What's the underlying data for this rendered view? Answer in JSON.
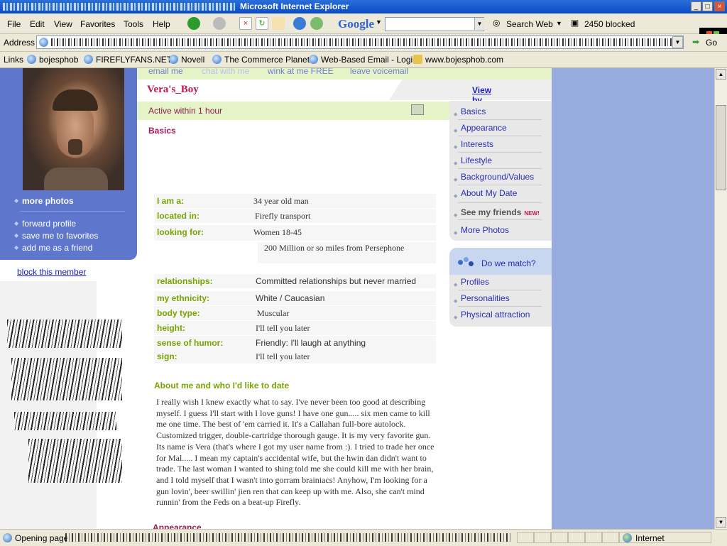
{
  "window": {
    "title": "Microsoft Internet Explorer",
    "controls": [
      "_",
      "□",
      "×"
    ]
  },
  "menubar": {
    "items": [
      "File",
      "Edit",
      "View",
      "Favorites",
      "Tools",
      "Help"
    ],
    "google_label": "Google",
    "search_web_label": "Search Web",
    "blocked_label": "2450 blocked"
  },
  "addressbar": {
    "label": "Address",
    "go_label": "Go"
  },
  "links": {
    "label": "Links",
    "items": [
      "bojesphob",
      "FIREFLYFANS.NET",
      "Novell",
      "The Commerce Planet",
      "Web-Based Email - Login",
      "www.bojesphob.com"
    ]
  },
  "left": {
    "more_photos": "more photos",
    "forward_profile": "forward profile",
    "save_favorites": "save me to favorites",
    "add_friend": "add me as a friend",
    "block_member": "block this member"
  },
  "center": {
    "tabs": [
      "email me",
      "chat with me",
      "wink at me FREE",
      "leave voicemail"
    ],
    "username": "Vera's_Boy",
    "view_by_section": "View by Section",
    "active_status": "Active within 1 hour",
    "basics_title": "Basics",
    "basics_rows": [
      {
        "label": "I am a:",
        "value": "34 year old man"
      },
      {
        "label": "located in:",
        "value": "Firefly transport"
      },
      {
        "label": "looking for:",
        "value": "Women 18-45"
      }
    ],
    "looking_extra": "200 Million or so miles from Persephone",
    "detail_rows": [
      {
        "label": "relationships:",
        "value": "Committed relationships but never married"
      },
      {
        "label": "my ethnicity:",
        "value": "White / Caucasian"
      },
      {
        "label": "body type:",
        "value": "Muscular"
      },
      {
        "label": "height:",
        "value": "I'll tell you later"
      },
      {
        "label": "sense of humor:",
        "value": "Friendly: I'll laugh at anything"
      },
      {
        "label": "sign:",
        "value": "I'll tell you later"
      }
    ],
    "about_title": "About me and who I'd like to date",
    "about_text": "I really wish I knew exactly what to say.  I've never been too good at describing myself.  I guess I'll start with I love guns! I have one gun..... six men came to kill me one time. The best of 'em carried it. It's a Callahan full-bore autolock. Customized trigger, double-cartridge thorough gauge. It is my very favorite gun. Its name is Vera (that's where I got my user name from :). I tried to trade her once for Mal..... I mean my captain's accidental wife, but the hwin dan didn't want to trade. The last woman I wanted to shing told me she could kill me with her brain, and I told myself that I wasn't into gorram brainiacs! Anyhow, I'm looking for a gun lovin', beer swillin' jien ren that can keep up with me. Also, she can't mind runnin' from the Feds on a beat-up Firefly.",
    "appearance_title": "Appearance"
  },
  "nav": {
    "items": [
      "Basics",
      "Appearance",
      "Interests",
      "Lifestyle",
      "Background/Values",
      "About My Date"
    ],
    "friends": "See my friends",
    "new_badge": "NEW!",
    "more_photos": "More Photos",
    "match": "Do we match?",
    "match_items": [
      "Profiles",
      "Personalities",
      "Physical attraction"
    ]
  },
  "status": {
    "text": "Opening page",
    "zone": "Internet"
  },
  "colors": {
    "brand_blue": "#5e76cc",
    "name_pink": "#c4154d",
    "label_green": "#79a300",
    "link_blue": "#2a2fb6"
  }
}
